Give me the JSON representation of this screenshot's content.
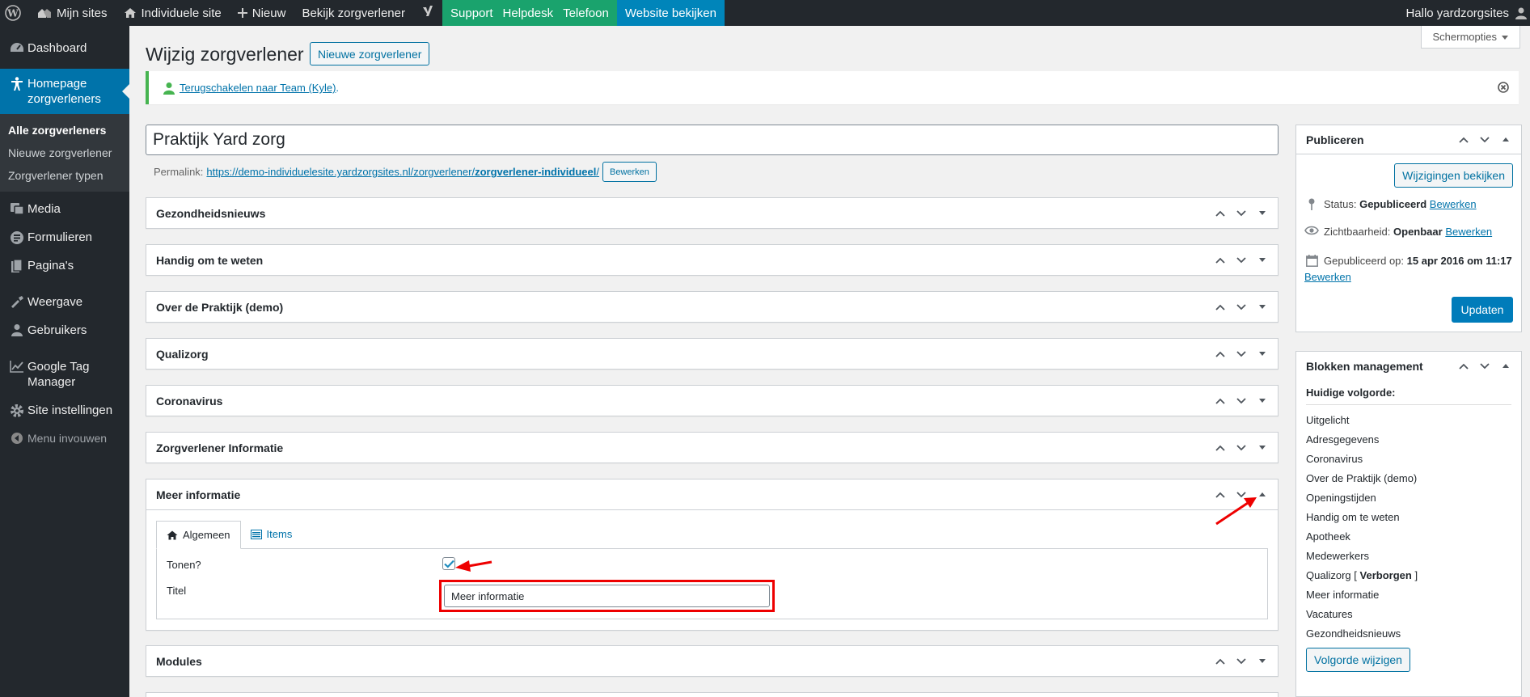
{
  "adminbar": {
    "my_sites": "Mijn sites",
    "site": "Individuele site",
    "new": "Nieuw",
    "view": "Bekijk zorgverlener",
    "support": "Support",
    "helpdesk": "Helpdesk",
    "telefoon": "Telefoon",
    "website": "Website bekijken",
    "greeting": "Hallo yardzorgsites"
  },
  "sidebar": {
    "dashboard": "Dashboard",
    "homepage_line1": "Homepage",
    "homepage_line2": "zorgverleners",
    "sub": [
      "Alle zorgverleners",
      "Nieuwe zorgverlener",
      "Zorgverlener typen"
    ],
    "media": "Media",
    "formulieren": "Formulieren",
    "paginas": "Pagina's",
    "weergave": "Weergave",
    "gebruikers": "Gebruikers",
    "gtm_line1": "Google Tag",
    "gtm_line2": "Manager",
    "site_instellingen": "Site instellingen",
    "menu_invouwen": "Menu invouwen"
  },
  "header": {
    "title": "Wijzig zorgverlener",
    "new_button": "Nieuwe zorgverlener",
    "screen_options": "Schermopties"
  },
  "notice": {
    "link": "Terugschakelen naar Team (Kyle)",
    "suffix": "."
  },
  "post": {
    "title": "Praktijk Yard zorg",
    "permalink_label": "Permalink:",
    "permalink_base": "https://demo-individuelesite.yardzorgsites.nl/zorgverlener/",
    "permalink_slug": "zorgverlener-individueel",
    "permalink_end": "/",
    "edit_button": "Bewerken"
  },
  "boxes": [
    "Gezondheidsnieuws",
    "Handig om te weten",
    "Over de Praktijk (demo)",
    "Qualizorg",
    "Coronavirus",
    "Zorgverlener Informatie"
  ],
  "meer_info": {
    "title": "Meer informatie",
    "tab_general": "Algemeen",
    "tab_items": "Items",
    "show_label": "Tonen?",
    "show_checked": true,
    "title_label": "Titel",
    "title_value": "Meer informatie"
  },
  "modules": {
    "title": "Modules"
  },
  "publish": {
    "title": "Publiceren",
    "preview_button": "Wijzigingen bekijken",
    "status_label": "Status:",
    "status_value": "Gepubliceerd",
    "visibility_label": "Zichtbaarheid:",
    "visibility_value": "Openbaar",
    "published_label": "Gepubliceerd op:",
    "published_value": "15 apr 2016 om 11:17",
    "edit_link": "Bewerken",
    "update_button": "Updaten"
  },
  "blocks": {
    "title": "Blokken management",
    "current_order": "Huidige volgorde:",
    "items": [
      "Uitgelicht",
      "Adresgegevens",
      "Coronavirus",
      "Over de Praktijk (demo)",
      "Openingstijden",
      "Handig om te weten",
      "Apotheek",
      "Medewerkers",
      "Qualizorg",
      "Meer informatie",
      "Vacatures",
      "Gezondheidsnieuws"
    ],
    "hidden_prefix": "[",
    "hidden_word": "Verborgen",
    "hidden_suffix": "]",
    "change_button": "Volgorde wijzigen"
  },
  "colors": {
    "accent": "#0073aa",
    "sidebar_bg": "#23282d",
    "support_green": "#1aa36d",
    "annotation_red": "#e00000"
  }
}
